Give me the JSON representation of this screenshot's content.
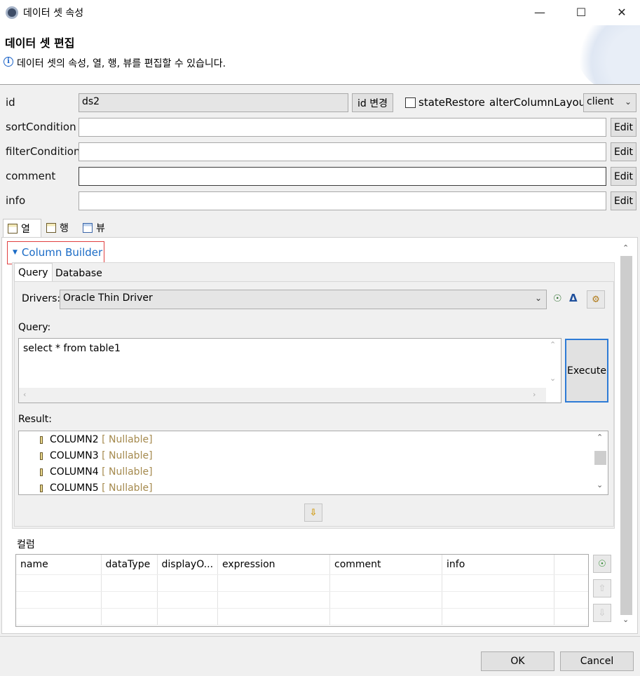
{
  "window": {
    "title": "데이터 셋 속성",
    "minimize": "—",
    "maximize": "☐",
    "close": "✕"
  },
  "header": {
    "title": "데이터 셋 편집",
    "description": "데이터 셋의 속성, 열, 행, 뷰를 편집할 수 있습니다.",
    "info_glyph": "i"
  },
  "form": {
    "id_label": "id",
    "id_value": "ds2",
    "id_change_button": "id 변경",
    "state_restore_label": "stateRestore",
    "state_restore_checked": false,
    "alter_column_layout_label": "alterColumnLayout",
    "alter_column_layout_value": "client",
    "sort_label": "sortCondition",
    "sort_value": "",
    "filter_label": "filterCondition",
    "filter_value": "",
    "comment_label": "comment",
    "comment_value": "",
    "info_label": "info",
    "info_value": "",
    "edit_button": "Edit"
  },
  "tabs": [
    {
      "label": "열",
      "icon": "column-table-icon",
      "active": true
    },
    {
      "label": "행",
      "icon": "row-table-icon",
      "active": false
    },
    {
      "label": "뷰",
      "icon": "view-table-icon",
      "active": false
    }
  ],
  "column_builder": {
    "toggle_label": "Column Builder",
    "subtabs": [
      "Query",
      "Database"
    ],
    "drivers_label": "Drivers:",
    "drivers_value": "Oracle Thin Driver",
    "query_label": "Query:",
    "query_value": "select * from table1",
    "execute_button": "Execute",
    "result_label": "Result:",
    "results": [
      {
        "name": "COLUMN2",
        "tag": "[ Nullable]"
      },
      {
        "name": "COLUMN3",
        "tag": "[ Nullable]"
      },
      {
        "name": "COLUMN4",
        "tag": "[ Nullable]"
      },
      {
        "name": "COLUMN5",
        "tag": "[ Nullable]"
      }
    ]
  },
  "columns_section": {
    "title": "컬럼",
    "headers": [
      "name",
      "dataType",
      "displayO...",
      "expression",
      "comment",
      "info"
    ]
  },
  "footer": {
    "ok": "OK",
    "cancel": "Cancel"
  },
  "colors": {
    "accent_link": "#1a6bc6",
    "highlight_border": "#e04040",
    "nullable": "#a58a4e",
    "execute_border": "#2e7bd6"
  }
}
